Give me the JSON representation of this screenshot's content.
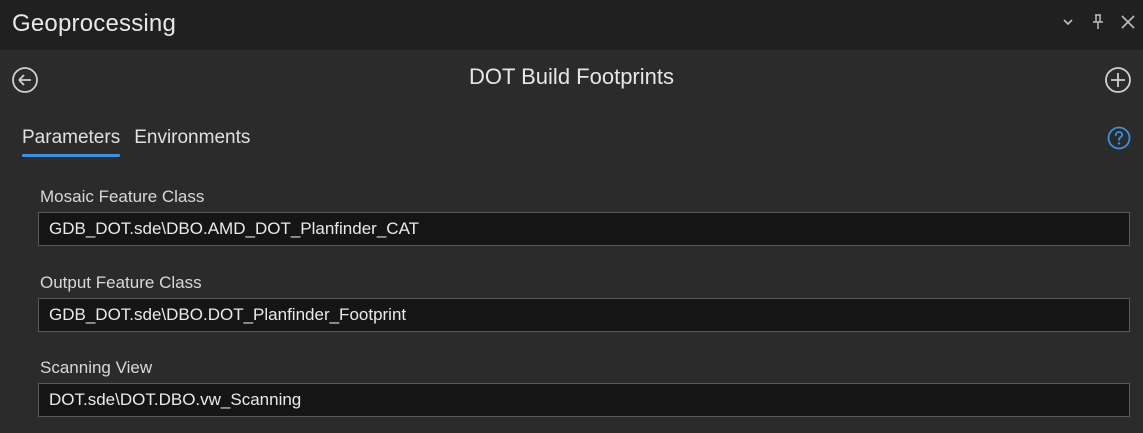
{
  "window": {
    "title": "Geoprocessing",
    "controls": {
      "dropdown_icon": "chevron-down-icon",
      "pin_icon": "pin-icon",
      "close_icon": "close-icon"
    }
  },
  "tool": {
    "title": "DOT Build Footprints",
    "back_icon": "back-arrow-icon",
    "add_icon": "add-icon"
  },
  "tabs": [
    {
      "label": "Parameters",
      "active": true
    },
    {
      "label": "Environments",
      "active": false
    }
  ],
  "help_icon": "help-icon",
  "parameters": [
    {
      "label": "Mosaic Feature Class",
      "value": "GDB_DOT.sde\\DBO.AMD_DOT_Planfinder_CAT"
    },
    {
      "label": "Output Feature Class",
      "value": "GDB_DOT.sde\\DBO.DOT_Planfinder_Footprint"
    },
    {
      "label": "Scanning View",
      "value": "DOT.sde\\DOT.DBO.vw_Scanning"
    }
  ],
  "colors": {
    "background": "#2b2b2b",
    "titlebar": "#202020",
    "accent": "#3d8fe0",
    "input_bg": "#151515"
  }
}
